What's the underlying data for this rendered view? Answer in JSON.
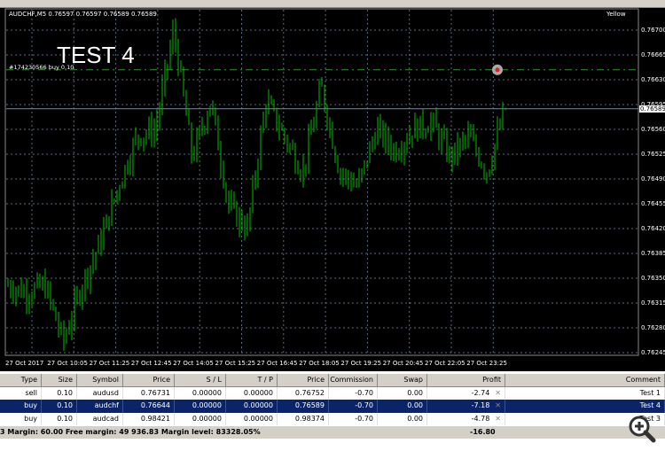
{
  "chart": {
    "symbol_header": "AUDCHF,M5  0.76597 0.76597 0.76589 0.76589",
    "account_label": "Yellow",
    "overlay_text": "TEST 4",
    "order_label": "#174230566 buy 0.10",
    "order_price": 0.76644,
    "bid_price": 0.76589,
    "bid_label": "0.76589",
    "bull_color": "#00c000",
    "price_ticks": [
      "0.76700",
      "0.76665",
      "0.76630",
      "0.76595",
      "0.76560",
      "0.76525",
      "0.76490",
      "0.76455",
      "0.76420",
      "0.76385",
      "0.76350",
      "0.76315",
      "0.76280",
      "0.76245"
    ],
    "time_ticks": [
      "27 Oct 2017",
      "27 Oct 10:05",
      "27 Oct 11:25",
      "27 Oct 12:45",
      "27 Oct 14:05",
      "27 Oct 15:25",
      "27 Oct 16:45",
      "27 Oct 18:05",
      "27 Oct 19:25",
      "27 Oct 20:45",
      "27 Oct 22:05",
      "27 Oct 23:25"
    ],
    "price_anchors": [
      0.7634,
      0.7633,
      0.7634,
      0.7626,
      0.7634,
      0.764,
      0.7648,
      0.7655,
      0.7656,
      0.767,
      0.7652,
      0.766,
      0.7645,
      0.7642,
      0.766,
      0.7655,
      0.765,
      0.7662,
      0.765,
      0.7648,
      0.7656,
      0.7653,
      0.7656,
      0.7657,
      0.7652,
      0.7655,
      0.765,
      0.7659
    ]
  },
  "table": {
    "headers": [
      "Type",
      "Size",
      "Symbol",
      "Price",
      "S / L",
      "T / P",
      "Price",
      "Commission",
      "Swap",
      "Profit",
      "Comment"
    ],
    "rows": [
      [
        "sell",
        "0.10",
        "audusd",
        "0.76731",
        "0.00000",
        "0.00000",
        "0.76752",
        "-0.70",
        "0.00",
        "-2.74",
        "Test 1"
      ],
      [
        "buy",
        "0.10",
        "audchf",
        "0.76644",
        "0.00000",
        "0.00000",
        "0.76589",
        "-0.70",
        "0.00",
        "-7.18",
        "Test 4"
      ],
      [
        "buy",
        "0.10",
        "audcad",
        "0.98421",
        "0.00000",
        "0.00000",
        "0.98374",
        "-0.70",
        "0.00",
        "-4.78",
        "Test 3"
      ]
    ],
    "selected_row": 1,
    "footer": "3  Margin: 60.00  Free margin: 49 936.83  Margin level: 83328.05%",
    "total_profit": "-16.80"
  }
}
